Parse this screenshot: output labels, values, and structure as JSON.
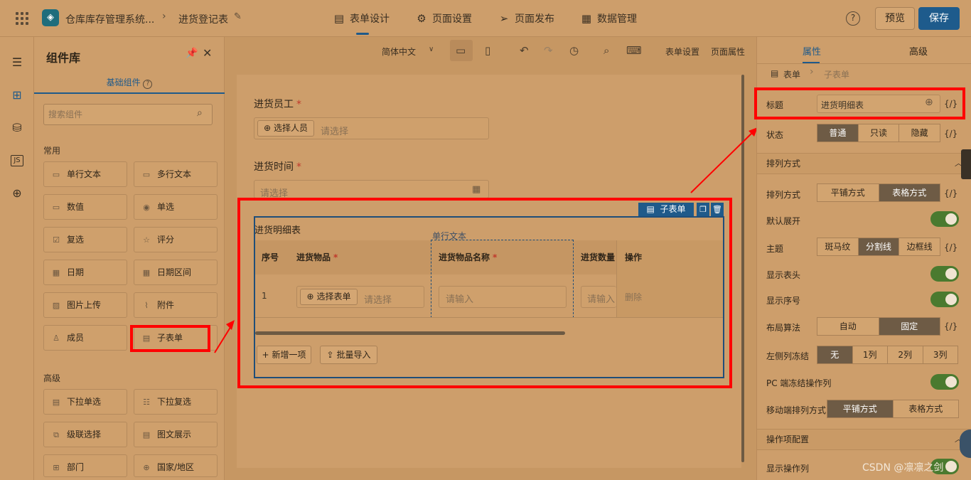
{
  "topbar": {
    "app_name": "仓库库存管理系统...",
    "breadcrumb_page": "进货登记表",
    "nav": [
      "表单设计",
      "页面设置",
      "页面发布",
      "数据管理"
    ],
    "help": "?",
    "preview_label": "预览",
    "save_label": "保存"
  },
  "library": {
    "title": "组件库",
    "tab": "基础组件",
    "search_placeholder": "搜索组件",
    "common_label": "常用",
    "common": [
      "单行文本",
      "多行文本",
      "数值",
      "单选",
      "复选",
      "评分",
      "日期",
      "日期区间",
      "图片上传",
      "附件",
      "成员",
      "子表单"
    ],
    "advanced_label": "高级",
    "advanced": [
      "下拉单选",
      "下拉复选",
      "级联选择",
      "图文展示",
      "部门",
      "国家/地区"
    ]
  },
  "toolbar": {
    "language": "简体中文",
    "form_settings": "表单设置",
    "page_props": "页面属性"
  },
  "form": {
    "employee_label": "进货员工",
    "select_person_btn": "选择人员",
    "select_placeholder": "请选择",
    "time_label": "进货时间",
    "time_placeholder": "请选择",
    "subform_tag": "子表单",
    "subform_title": "进货明细表",
    "hover_label": "单行文本",
    "columns": [
      "序号",
      "进货物品",
      "进货物品名称",
      "进货数量",
      "操作"
    ],
    "row": {
      "index": "1",
      "select_form_btn": "选择表单",
      "select_placeholder": "请选择",
      "input_placeholder": "请输入",
      "qty_placeholder": "请输入",
      "delete": "删除"
    },
    "add_row": "新增一项",
    "batch_import": "批量导入"
  },
  "props": {
    "tabs": [
      "属性",
      "高级"
    ],
    "crumb_root": "表单",
    "crumb_current": "子表单",
    "title_label": "标题",
    "title_value": "进货明细表",
    "state_label": "状态",
    "state_options": [
      "普通",
      "只读",
      "隐藏"
    ],
    "layout_group": "排列方式",
    "layout_label": "排列方式",
    "layout_options": [
      "平铺方式",
      "表格方式"
    ],
    "default_expand": "默认展开",
    "theme_label": "主题",
    "theme_options": [
      "斑马纹",
      "分割线",
      "边框线"
    ],
    "show_header": "显示表头",
    "show_index": "显示序号",
    "layout_algo": "布局算法",
    "layout_algo_options": [
      "自动",
      "固定"
    ],
    "left_freeze": "左侧列冻结",
    "left_freeze_options": [
      "无",
      "1列",
      "2列",
      "3列"
    ],
    "pc_freeze_op": "PC 端冻结操作列",
    "mobile_layout": "移动端排列方式",
    "mobile_options": [
      "平铺方式",
      "表格方式"
    ],
    "op_group": "操作项配置",
    "show_op_col": "显示操作列",
    "brace": "{/}"
  },
  "watermark": "CSDN @凛凛之剑",
  "colors": {
    "accent": "#1f5a8a",
    "highlight": "#ff0000",
    "toggle_on": "#4a7a2f"
  }
}
